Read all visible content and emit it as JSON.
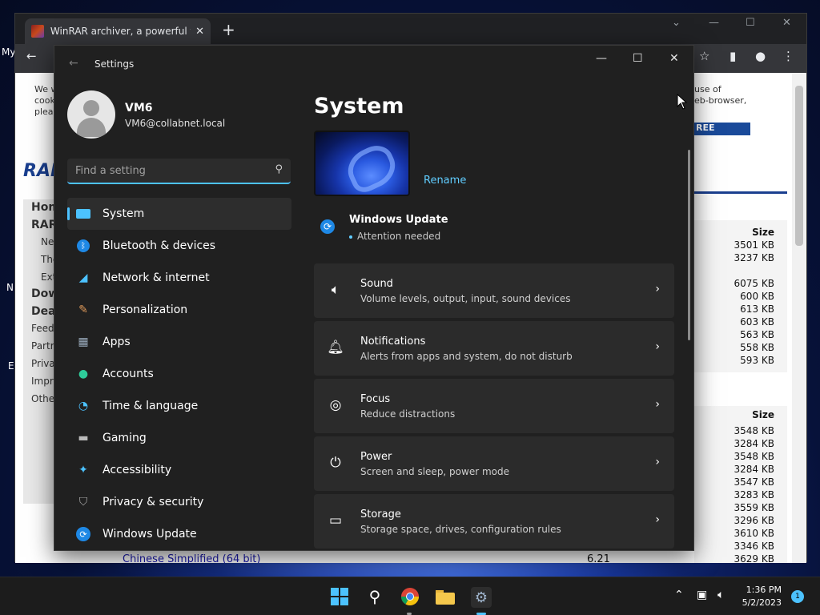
{
  "desktop": {
    "left_labels": [
      "My",
      "N",
      "E"
    ]
  },
  "chrome": {
    "tab_title": "WinRAR archiver, a powerful too",
    "tab_close": "✕",
    "new_tab": "+",
    "window_controls": [
      "⌄",
      "—",
      "☐",
      "✕"
    ],
    "page": {
      "cookie_text_lines": [
        "We w",
        "cook",
        "pleas"
      ],
      "cookie_right_lines": [
        "use of",
        "eb-browser,"
      ],
      "cookie_button": "REE",
      "logo": "RAR",
      "left_menu": [
        "Hom",
        "RAR",
        "Ne",
        "The",
        "Ext",
        "Dow",
        "Dea",
        "Feed",
        "Partr",
        "Priva",
        "Impr",
        "Othe"
      ],
      "size_header_1": "Size",
      "sizes_1": [
        "3501 KB",
        "3237 KB",
        "",
        "6075 KB",
        "600 KB",
        "613 KB",
        "603 KB",
        "563 KB",
        "558 KB",
        "593 KB"
      ],
      "size_header_2": "Size",
      "sizes_2": [
        "3548 KB",
        "3284 KB",
        "3548 KB",
        "3284 KB",
        "3547 KB",
        "3283 KB",
        "3559 KB",
        "3296 KB",
        "3610 KB",
        "3346 KB",
        "3629 KB"
      ],
      "bottom_link": "Chinese Simplified (64 bit)",
      "bottom_version": "6.21"
    }
  },
  "settings": {
    "app_title": "Settings",
    "window_controls": {
      "minimize": "—",
      "maximize": "☐",
      "close": "✕"
    },
    "user": {
      "name": "VM6",
      "email": "VM6@collabnet.local"
    },
    "search": {
      "placeholder": "Find a setting",
      "icon": "search-icon"
    },
    "nav": [
      {
        "label": "System",
        "icon": "system-icon",
        "color": "#4cc2ff",
        "active": true
      },
      {
        "label": "Bluetooth & devices",
        "icon": "bluetooth-icon",
        "color": "#1e88e5"
      },
      {
        "label": "Network & internet",
        "icon": "wifi-icon",
        "color": "#4cc2ff"
      },
      {
        "label": "Personalization",
        "icon": "brush-icon",
        "color": "#e09a5a"
      },
      {
        "label": "Apps",
        "icon": "apps-icon",
        "color": "#9ab"
      },
      {
        "label": "Accounts",
        "icon": "accounts-icon",
        "color": "#2ecc9a"
      },
      {
        "label": "Time & language",
        "icon": "globe-clock-icon",
        "color": "#4cc2ff"
      },
      {
        "label": "Gaming",
        "icon": "gamepad-icon",
        "color": "#bbb"
      },
      {
        "label": "Accessibility",
        "icon": "accessibility-icon",
        "color": "#4cc2ff"
      },
      {
        "label": "Privacy & security",
        "icon": "shield-icon",
        "color": "#aaa"
      },
      {
        "label": "Windows Update",
        "icon": "update-icon",
        "color": "#1e88e5"
      }
    ],
    "main": {
      "title": "System",
      "rename": "Rename",
      "windows_update": {
        "title": "Windows Update",
        "status": "Attention needed"
      },
      "cards": [
        {
          "title": "Sound",
          "subtitle": "Volume levels, output, input, sound devices",
          "icon": "speaker-icon"
        },
        {
          "title": "Notifications",
          "subtitle": "Alerts from apps and system, do not disturb",
          "icon": "bell-icon"
        },
        {
          "title": "Focus",
          "subtitle": "Reduce distractions",
          "icon": "focus-icon"
        },
        {
          "title": "Power",
          "subtitle": "Screen and sleep, power mode",
          "icon": "power-icon"
        },
        {
          "title": "Storage",
          "subtitle": "Storage space, drives, configuration rules",
          "icon": "storage-icon"
        }
      ]
    }
  },
  "taskbar": {
    "apps": [
      "start-icon",
      "search-icon",
      "chrome-icon",
      "file-explorer-icon",
      "settings-icon"
    ],
    "time": "1:36 PM",
    "date": "5/2/2023",
    "notification_count": "1"
  }
}
